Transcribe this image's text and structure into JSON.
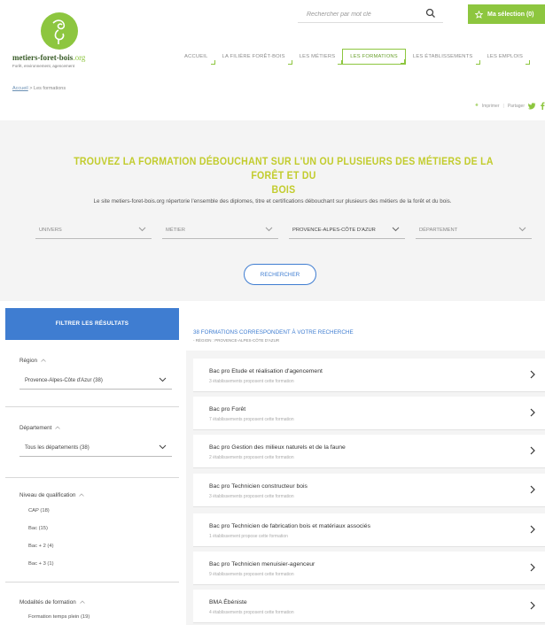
{
  "header": {
    "logo_name": "metiers-foret-bois",
    "logo_tld": ".org",
    "logo_tagline": "Forêt, environnement, agencement",
    "search_placeholder": "Rechercher par mot clé",
    "selection_label": "Ma sélection (0)"
  },
  "nav": [
    {
      "label": "ACCUEIL",
      "active": false
    },
    {
      "label": "LA FILIÈRE FORÊT-BOIS",
      "active": false
    },
    {
      "label": "LES MÉTIERS",
      "active": false
    },
    {
      "label": "LES FORMATIONS",
      "active": true
    },
    {
      "label": "LES ÉTABLISSEMENTS",
      "active": false
    },
    {
      "label": "LES EMPLOIS",
      "active": false
    }
  ],
  "breadcrumb": {
    "home": "Accueil",
    "separator": " > ",
    "current": "Les formations"
  },
  "share": {
    "print_label": "Imprimer",
    "share_label": "Partager"
  },
  "hero": {
    "title_line1": "TROUVEZ LA FORMATION DÉBOUCHANT SUR L'UN OU PLUSIEURS DES MÉTIERS DE LA FORÊT ET DU",
    "title_line2": "BOIS",
    "description": "Le site metiers-foret-bois.org répertorie l'ensemble des diplomes, titre et certifications débouchant sur plusieurs des métiers de la forêt et du bois.",
    "filters": [
      {
        "label": "UNIVERS",
        "filled": false
      },
      {
        "label": "MÉTIER",
        "filled": false
      },
      {
        "label": "PROVENCE-ALPES-CÔTE D'AZUR",
        "filled": true
      },
      {
        "label": "DÉPARTEMENT",
        "filled": false
      }
    ],
    "search_button": "RECHERCHER"
  },
  "sidebar": {
    "header": "FILTRER LES RÉSULTATS",
    "region": {
      "title": "Région",
      "value": "Provence-Alpes-Côte d'Azur (38)"
    },
    "departement": {
      "title": "Département",
      "value": "Tous les départements (38)"
    },
    "niveau": {
      "title": "Niveau de qualification",
      "options": [
        "CAP (18)",
        "Bac (15)",
        "Bac + 2 (4)",
        "Bac + 3 (1)"
      ]
    },
    "modalites": {
      "title": "Modalités de formation",
      "options": [
        "Formation temps plein (19)"
      ]
    }
  },
  "results": {
    "title": "38 FORMATIONS CORRESPONDENT À VOTRE RECHERCHE",
    "subtitle": "- RÉGION : PROVENCE-ALPES-CÔTE D'AZUR",
    "items": [
      {
        "name": "Bac pro Etude et réalisation d'agencement",
        "count": "3 établissements proposent cette formation"
      },
      {
        "name": "Bac pro Forêt",
        "count": "7 établissements proposent cette formation"
      },
      {
        "name": "Bac pro Gestion des milieux naturels et de la faune",
        "count": "2 établissements proposent cette formation"
      },
      {
        "name": "Bac pro Technicien constructeur bois",
        "count": "3 établissements proposent cette formation"
      },
      {
        "name": "Bac pro Technicien de fabrication bois et matériaux associés",
        "count": "1 établissement propose cette formation"
      },
      {
        "name": "Bac pro Technicien menuisier-agenceur",
        "count": "9 établissements proposent cette formation"
      },
      {
        "name": "BMA Ébéniste",
        "count": "4 établissements proposent cette formation"
      }
    ]
  },
  "colors": {
    "brand_green": "#8dc63f",
    "hero_title": "#c2cc2d",
    "accent_blue": "#3f7dd1"
  },
  "icons": [
    "logo-leaf-icon",
    "search-icon",
    "star-icon",
    "chevron-down-icon",
    "caret-up-icon",
    "chevron-right-icon",
    "print-icon",
    "twitter-icon",
    "facebook-icon"
  ]
}
